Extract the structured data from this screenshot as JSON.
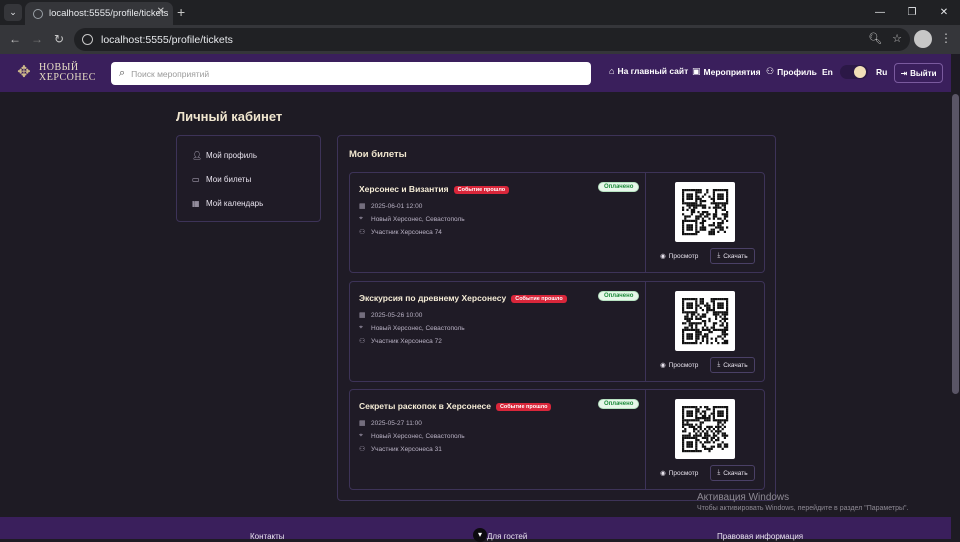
{
  "browser": {
    "tab_title": "localhost:5555/profile/tickets",
    "url": "localhost:5555/profile/tickets"
  },
  "header": {
    "logo_line1": "НОВЫЙ",
    "logo_line2": "ХЕРСОНЕС",
    "search_placeholder": "Поиск мероприятий",
    "nav": {
      "home": "На главный сайт",
      "events": "Мероприятия",
      "profile": "Профиль"
    },
    "lang_en": "En",
    "lang_ru": "Ru",
    "logout": "Выйти"
  },
  "page": {
    "title": "Личный кабинет"
  },
  "sidebar": {
    "items": [
      {
        "label": "Мой профиль",
        "icon": "user-icon"
      },
      {
        "label": "Мои билеты",
        "icon": "ticket-icon"
      },
      {
        "label": "Мой календарь",
        "icon": "calendar-icon"
      }
    ]
  },
  "tickets": {
    "title": "Мои билеты",
    "view_label": "Просмотр",
    "download_label": "Скачать",
    "items": [
      {
        "title": "Херсонес и Византия",
        "past_badge": "Событие прошло",
        "status": "Оплачено",
        "datetime": "2025-06-01 12:00",
        "location": "Новый Херсонес, Севастополь",
        "participant": "Участник Херсонеса 74"
      },
      {
        "title": "Экскурсия по древнему Херсонесу",
        "past_badge": "Событие прошло",
        "status": "Оплачено",
        "datetime": "2025-05-26 10:00",
        "location": "Новый Херсонес, Севастополь",
        "participant": "Участник Херсонеса 72"
      },
      {
        "title": "Секреты раскопок в Херсонесе",
        "past_badge": "Событие прошло",
        "status": "Оплачено",
        "datetime": "2025-05-27 11:00",
        "location": "Новый Херсонес, Севастополь",
        "participant": "Участник Херсонеса 31"
      }
    ]
  },
  "footer": {
    "col1": "Контакты",
    "col2": "Для гостей",
    "col3": "Правовая информация"
  },
  "watermark": {
    "line1": "Активация Windows",
    "line2": "Чтобы активировать Windows, перейдите в раздел \"Параметры\"."
  },
  "colors": {
    "header_bg": "#3a1f5c",
    "page_bg": "#1e1b24",
    "accent_gold": "#f0e6cf",
    "badge_past": "#d9263a",
    "badge_paid": "#1c8a3a"
  }
}
